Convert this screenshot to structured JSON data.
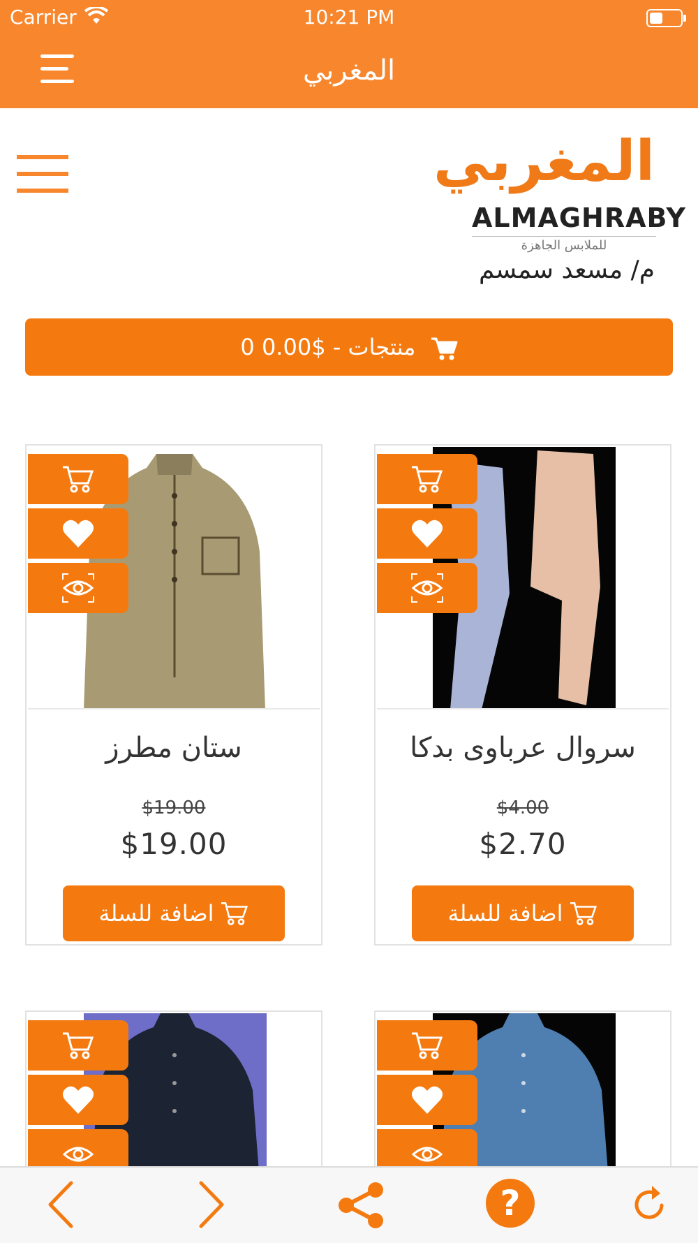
{
  "status": {
    "carrier": "Carrier",
    "time": "10:21 PM"
  },
  "nav": {
    "title": "المغربي"
  },
  "logo": {
    "arabic": "المغربي",
    "english": "ALMAGHRABY",
    "tagline": "للملابس الجاهزة",
    "owner": "م/ مسعد سمسم"
  },
  "cart": {
    "label": "0 منتجات - $0.00"
  },
  "products": [
    {
      "name": "ستان مطرز",
      "old_price": "$19.00",
      "price": "$19.00",
      "add_label": "اضافة للسلة"
    },
    {
      "name": "سروال عرباوى بدكا",
      "old_price": "$4.00",
      "price": "$2.70",
      "add_label": "اضافة للسلة"
    }
  ],
  "colors": {
    "brand": "#f47a10",
    "header": "#f7862c"
  },
  "toolbar": {
    "icons": [
      "back-icon",
      "forward-icon",
      "share-icon",
      "help-icon",
      "refresh-icon"
    ],
    "help_glyph": "?"
  }
}
